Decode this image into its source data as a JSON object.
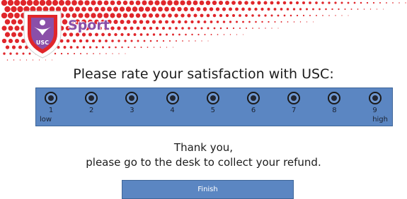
{
  "header": {
    "brand": "Sport",
    "logo_text": "USC"
  },
  "rating": {
    "question": "Please rate your satisfaction with USC:",
    "options": [
      "1",
      "2",
      "3",
      "4",
      "5",
      "6",
      "7",
      "8",
      "9"
    ],
    "low_label": "low",
    "high_label": "high"
  },
  "message": {
    "line1": "Thank you,",
    "line2": "please go to the desk to collect your refund."
  },
  "finish_button": {
    "label": "Finish"
  },
  "colors": {
    "accent_red": "#e0262b",
    "panel_blue": "#5b86c2",
    "brand_purple": "#8a4fa8"
  }
}
